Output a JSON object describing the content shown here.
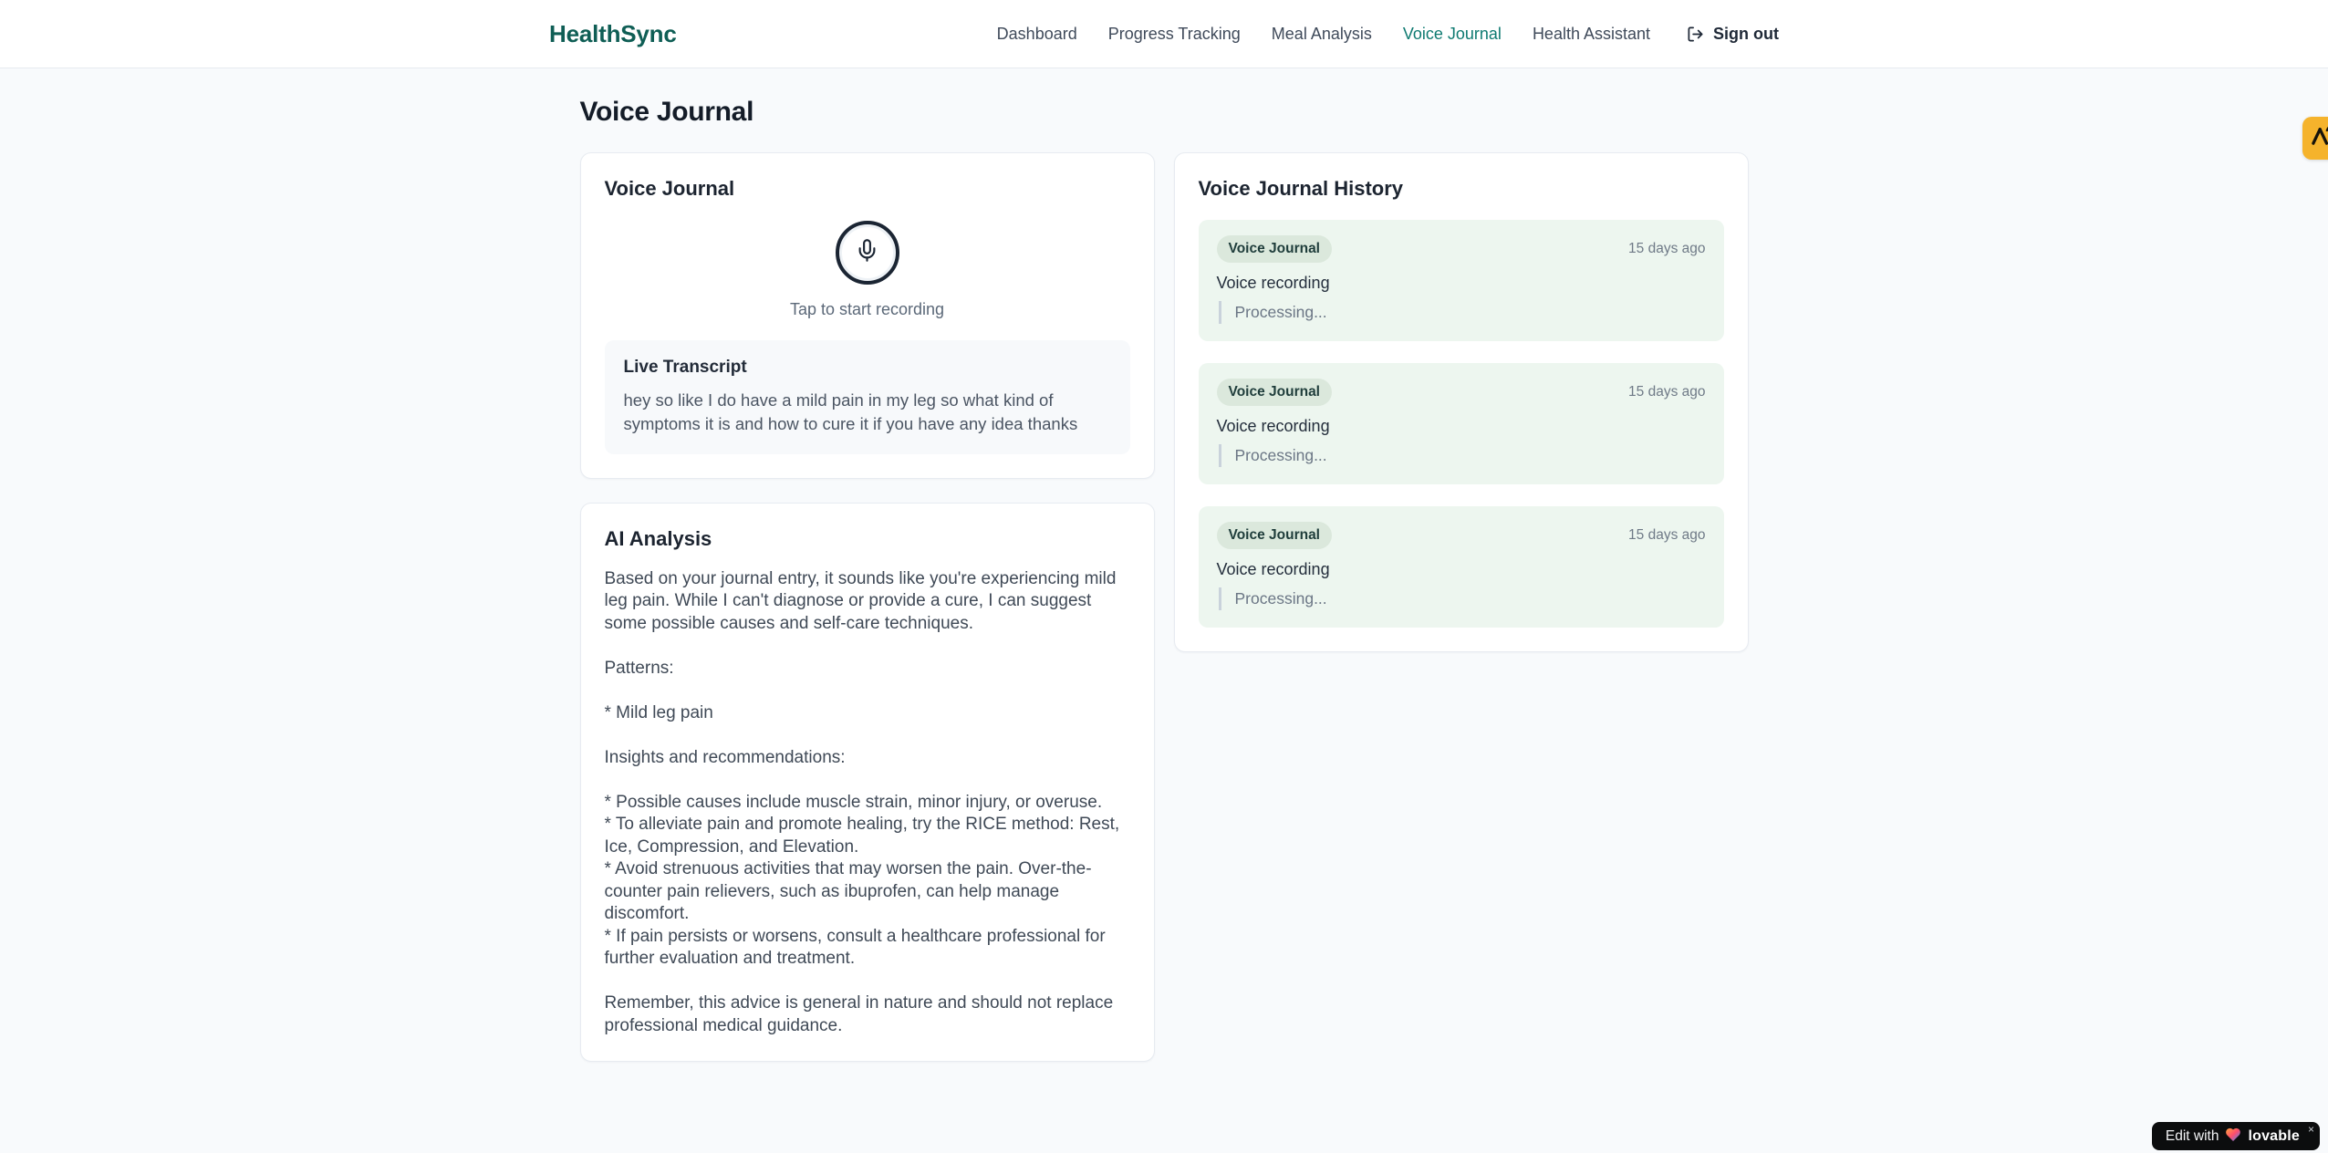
{
  "brand": {
    "name": "HealthSync",
    "color": "#0f5e55"
  },
  "nav": {
    "items": [
      {
        "label": "Dashboard",
        "active": false
      },
      {
        "label": "Progress Tracking",
        "active": false
      },
      {
        "label": "Meal Analysis",
        "active": false
      },
      {
        "label": "Voice Journal",
        "active": true
      },
      {
        "label": "Health Assistant",
        "active": false
      }
    ],
    "sign_out_label": "Sign out"
  },
  "page": {
    "title": "Voice Journal"
  },
  "recorder": {
    "card_title": "Voice Journal",
    "tap_hint": "Tap to start recording",
    "transcript_title": "Live Transcript",
    "transcript_text": "hey so like I do have a mild pain in my leg so what kind of symptoms it is and how to cure it if you have any idea thanks"
  },
  "analysis": {
    "card_title": "AI Analysis",
    "body": "Based on your journal entry, it sounds like you're experiencing mild leg pain. While I can't diagnose or provide a cure, I can suggest some possible causes and self-care techniques.\n\nPatterns:\n\n* Mild leg pain\n\nInsights and recommendations:\n\n* Possible causes include muscle strain, minor injury, or overuse.\n* To alleviate pain and promote healing, try the RICE method: Rest, Ice, Compression, and Elevation.\n* Avoid strenuous activities that may worsen the pain. Over-the-counter pain relievers, such as ibuprofen, can help manage discomfort.\n* If pain persists or worsens, consult a healthcare professional for further evaluation and treatment.\n\nRemember, this advice is general in nature and should not replace professional medical guidance."
  },
  "history": {
    "card_title": "Voice Journal History",
    "entries": [
      {
        "badge": "Voice Journal",
        "time": "15 days ago",
        "label": "Voice recording",
        "status": "Processing..."
      },
      {
        "badge": "Voice Journal",
        "time": "15 days ago",
        "label": "Voice recording",
        "status": "Processing..."
      },
      {
        "badge": "Voice Journal",
        "time": "15 days ago",
        "label": "Voice recording",
        "status": "Processing..."
      }
    ],
    "entry_bg_color": "#edf6ef",
    "badge_bg_color": "#dbe8dc",
    "badge_text_color": "#1f3d3b"
  },
  "overlays": {
    "edit_badge": {
      "prefix": "Edit with",
      "brand": "lovable",
      "close": "×"
    },
    "extension_badge_color": "#f5b32c"
  },
  "accent_color": "#0e7a71"
}
